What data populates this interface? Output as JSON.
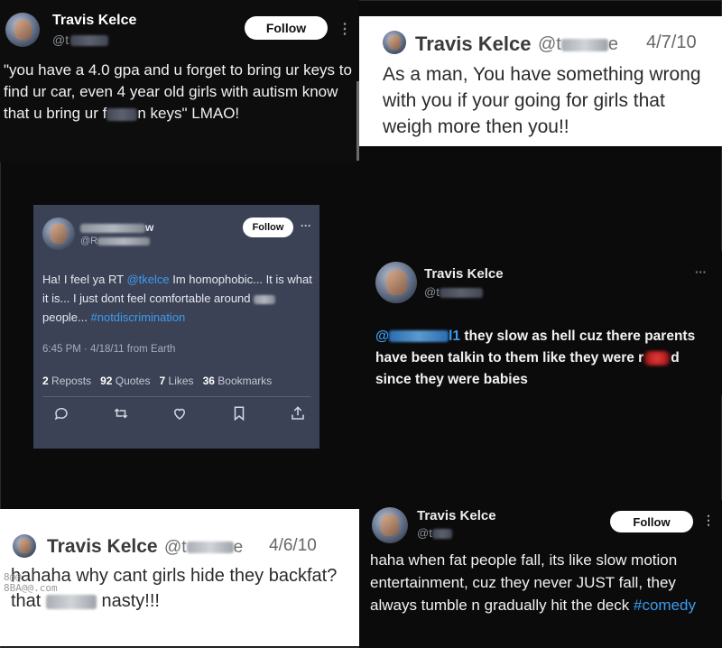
{
  "panel1": {
    "name": "Travis Kelce",
    "handle_prefix": "@t",
    "follow_label": "Follow",
    "menu_icon": "⋮",
    "text_a": "\"you have a 4.0 gpa and u forget to bring ur keys to find ur car, even 4 year old girls with autism know that u bring ur f",
    "text_b": "n keys\" LMAO!"
  },
  "panel2": {
    "name": "Travis Kelce",
    "handle_prefix": "@t",
    "handle_suffix": "e",
    "date": "4/7/10",
    "text": "As a man, You have something wrong with you if your going for girls that weigh more then you!!"
  },
  "panel3": {
    "name_suffix": "w",
    "handle_prefix": "@R",
    "follow_label": "Follow",
    "menu_icon": "···",
    "text_a": "Ha! I feel ya RT ",
    "mention": "@tkelce",
    "text_b": " Im homophobic... It is what it is... I just dont feel comfortable around ",
    "text_c": " people... ",
    "hashtag": "#notdiscrimination",
    "meta": "6:45 PM · 4/18/11 from Earth",
    "stats": [
      {
        "num": "2",
        "label": "Reposts"
      },
      {
        "num": "92",
        "label": "Quotes"
      },
      {
        "num": "7",
        "label": "Likes"
      },
      {
        "num": "36",
        "label": "Bookmarks"
      }
    ],
    "icons": [
      "reply-icon",
      "repost-icon",
      "like-icon",
      "bookmark-icon",
      "share-icon"
    ]
  },
  "panel4": {
    "name": "Travis Kelce",
    "handle_prefix": "@t",
    "menu_icon": "···",
    "mention_prefix": "@",
    "mention_suffix": "l1",
    "text_a": " they slow as hell cuz there parents have been talkin to them like they were r",
    "text_b": "d since they were babies"
  },
  "panel5": {
    "name": "Travis Kelce",
    "handle_prefix": "@t",
    "handle_suffix": "e",
    "date": "4/6/10",
    "text_a": "hahaha why cant girls hide they backfat? that ",
    "text_b": " nasty!!!",
    "watermark": "8@@\n8BA@@.com"
  },
  "panel6": {
    "name": "Travis Kelce",
    "handle_prefix": "@t",
    "follow_label": "Follow",
    "menu_icon": "⋮",
    "text": "haha when fat people fall, its like slow motion entertainment, cuz they never JUST fall, they always tumble n gradually hit the deck ",
    "hashtag": "#comedy"
  },
  "colors": {
    "background": "#0b0b0c",
    "link": "#3b9cf0",
    "card": "#3c4256",
    "white_panel": "#ffffff"
  }
}
